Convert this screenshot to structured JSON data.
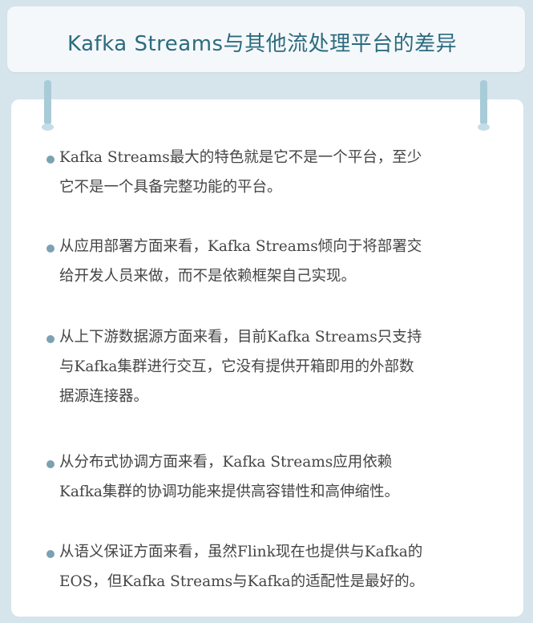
{
  "title": "Kafka Streams与其他流处理平台的差异",
  "items": [
    {
      "lines": [
        "Kafka Streams最大的特色就是它不是一个平台，至少",
        "它不是一个具备完整功能的平台。"
      ]
    },
    {
      "lines": [
        "从应用部署方面来看，Kafka Streams倾向于将部署交",
        "给开发人员来做，而不是依赖框架自己实现。"
      ]
    },
    {
      "lines": [
        "从上下游数据源方面来看，目前Kafka Streams只支持",
        "与Kafka集群进行交互，它没有提供开箱即用的外部数",
        "据源连接器。"
      ]
    },
    {
      "lines": [
        "从分布式协调方面来看，Kafka Streams应用依赖",
        "Kafka集群的协调功能来提供高容错性和高伸缩性。"
      ]
    },
    {
      "lines": [
        "从语义保证方面来看，虽然Flink现在也提供与Kafka的",
        "EOS，但Kafka Streams与Kafka的适配性是最好的。"
      ]
    }
  ],
  "colors": {
    "title": "#2b6b7f",
    "bullet": "#7ba1b3",
    "text": "#454545",
    "background": "#d6e4ec"
  }
}
